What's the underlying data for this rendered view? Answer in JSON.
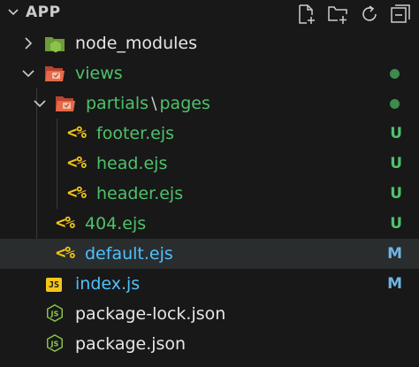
{
  "explorer": {
    "title": "APP",
    "actions": [
      {
        "name": "new-file-icon"
      },
      {
        "name": "new-folder-icon"
      },
      {
        "name": "refresh-icon"
      },
      {
        "name": "collapse-all-icon"
      }
    ]
  },
  "tree": {
    "node_modules": {
      "label": "node_modules",
      "icon": "folder-node-icon"
    },
    "views": {
      "label": "views",
      "icon": "folder-views-icon"
    },
    "partials": {
      "label_part1": "partials",
      "sep": "\\",
      "label_part2": "pages",
      "icon": "folder-views-icon"
    },
    "footer": {
      "label": "footer.ejs",
      "icon_text": "<%",
      "status": "U"
    },
    "head": {
      "label": "head.ejs",
      "icon_text": "<%",
      "status": "U"
    },
    "header": {
      "label": "header.ejs",
      "icon_text": "<%",
      "status": "U"
    },
    "notfound": {
      "label": "404.ejs",
      "icon_text": "<%",
      "status": "U"
    },
    "default": {
      "label": "default.ejs",
      "icon_text": "<%",
      "status": "M"
    },
    "index": {
      "label": "index.js",
      "icon_text": "JS",
      "status": "M"
    },
    "package_lock": {
      "label": "package-lock.json",
      "icon": "nodejs-icon"
    },
    "package": {
      "label": "package.json",
      "icon": "nodejs-icon"
    }
  },
  "colors": {
    "background": "#181818",
    "selected_row": "#2a2d2e",
    "untracked": "#4ec26a",
    "modified": "#6cb6e8",
    "ejs_icon": "#f5c518",
    "folder_icon": "#e8684a",
    "node_folder_icon": "#8bc34a",
    "js_icon": "#f5c518"
  }
}
